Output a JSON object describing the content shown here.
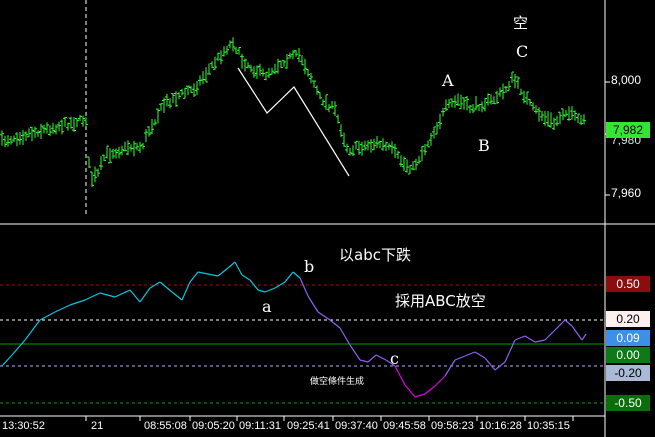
{
  "price_panel": {
    "axis_labels": [
      "8,000",
      "7,960"
    ],
    "last_price_badge": "7,982",
    "partial_label": "7,980"
  },
  "indicator_panel": {
    "level_badges": [
      {
        "label": "0.50",
        "bg": "#8b0d0d",
        "fg": "#ffffff"
      },
      {
        "label": "0.20",
        "bg": "#fff0f0",
        "fg": "#000000"
      },
      {
        "label": "0.09",
        "bg": "#3d90e8",
        "fg": "#ffffff"
      },
      {
        "label": "0.00",
        "bg": "#0c7a16",
        "fg": "#ffffff"
      },
      {
        "label": "-0.20",
        "bg": "#a9b9d6",
        "fg": "#000000"
      },
      {
        "label": "-0.50",
        "bg": "#0a6e0a",
        "fg": "#ffffff"
      }
    ]
  },
  "annotations": {
    "price_kong": "空",
    "price_C": "C",
    "price_A": "A",
    "price_B": "B",
    "ind_title": "以abc下跌",
    "ind_b": "b",
    "ind_a": "a",
    "ind_strategy": "採用ABC放空",
    "ind_c": "c",
    "ind_condition": "做空條件生成"
  },
  "time_axis": {
    "labels": [
      "13:30:52",
      "21",
      "08:55:08",
      "09:05:20",
      "09:11:31",
      "09:25:41",
      "09:37:40",
      "09:45:58",
      "09:58:23",
      "10:16:28",
      "10:35:15"
    ]
  },
  "colors": {
    "price_bars": "#32ff32",
    "indicator_up": "#00c8e0",
    "indicator_down": "#9060f0",
    "indicator_low": "#e000e0",
    "line_050": "#c00000",
    "line_020": "#ffffff",
    "line_000": "#00a000",
    "line_m020": "#b0b0ff",
    "line_m050": "#00a000",
    "session_divider": "#ffffff"
  },
  "chart_data": {
    "type": "ohlc",
    "price_axis_ticks": [
      7960,
      8000
    ],
    "last_price": 7982,
    "indicator_levels": [
      0.5,
      0.2,
      0.09,
      0.0,
      -0.2,
      -0.5
    ],
    "indicator_current": 0.09
  }
}
